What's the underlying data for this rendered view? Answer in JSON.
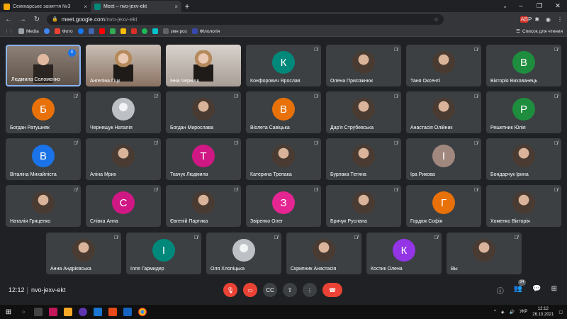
{
  "tabs": [
    {
      "label": "Семінарське заняття №3",
      "close": "×",
      "icon": "document-icon",
      "color": "#f9ab00"
    },
    {
      "label": "Meet – nvo-jexv-ekt",
      "close": "×",
      "icon": "meet-icon",
      "color": "#00897b"
    }
  ],
  "new_tab": "+",
  "window_controls": [
    "–",
    "❐",
    "✕"
  ],
  "toolbar": {
    "url_host": "meet.google.com",
    "url_path": "/nvo-jexv-ekt",
    "icons": [
      "star-icon",
      "extension-icon",
      "profile-icon",
      "menu-icon"
    ]
  },
  "bookmarks": [
    {
      "label": "Media",
      "color": "#9aa0a6"
    },
    {
      "label": "",
      "color": "#4285f4"
    },
    {
      "label": "Фото",
      "color": "#ea4335"
    },
    {
      "label": "",
      "color": "#1877f2"
    },
    {
      "label": "",
      "color": "#4267b2"
    },
    {
      "label": "",
      "color": "#ff0000"
    },
    {
      "label": "",
      "color": "#34a853"
    },
    {
      "label": "",
      "color": "#fbbc04"
    },
    {
      "label": "",
      "color": "#d93025"
    },
    {
      "label": "",
      "color": "#1db954"
    },
    {
      "label": "",
      "color": "#00c4cc"
    },
    {
      "label": "змн роз",
      "color": "#5f6368"
    },
    {
      "label": "Філологія",
      "color": "#3949ab"
    }
  ],
  "reading_list": "Список для чтения",
  "participants": [
    {
      "name": "Людмила Соломенко",
      "kind": "video"
    },
    {
      "name": "Ангеліна Гіцк",
      "kind": "video"
    },
    {
      "name": "Інна Черниш",
      "kind": "video"
    },
    {
      "name": "Конфорович Ярослав",
      "initial": "К",
      "color": "#00897b"
    },
    {
      "name": "Олена Присяжнюк",
      "kind": "photo"
    },
    {
      "name": "Таня Оксенті",
      "kind": "photo"
    },
    {
      "name": "Вікторія Вихованець",
      "initial": "В",
      "color": "#1e8e3e"
    },
    {
      "name": "Богдан Ратушняк",
      "initial": "Б",
      "color": "#e8710a"
    },
    {
      "name": "Чернещук Наталія",
      "kind": "grey"
    },
    {
      "name": "Богдан Мирослава",
      "kind": "photo"
    },
    {
      "name": "Віолета Савіцька",
      "initial": "В",
      "color": "#e8710a"
    },
    {
      "name": "Дар'я Струбевська",
      "kind": "photo"
    },
    {
      "name": "Анастасія Олійник",
      "kind": "photo"
    },
    {
      "name": "Решетник Юлія",
      "initial": "Р",
      "color": "#1e8e3e"
    },
    {
      "name": "Віталіна Михайліста",
      "initial": "В",
      "color": "#1a73e8"
    },
    {
      "name": "Аліна Мрих",
      "kind": "photo"
    },
    {
      "name": "Ткачук Людмила",
      "initial": "Т",
      "color": "#d01884"
    },
    {
      "name": "Катерина Трепака",
      "kind": "photo"
    },
    {
      "name": "Бурлака Тетяна",
      "kind": "photo"
    },
    {
      "name": "Іра Рикова",
      "initial": "І",
      "color": "#a1887f"
    },
    {
      "name": "Бондарчук Ірина",
      "kind": "photo"
    },
    {
      "name": "Наталія Гриценко",
      "kind": "photo"
    },
    {
      "name": "Слівка Анна",
      "initial": "С",
      "color": "#d01884"
    },
    {
      "name": "Євгеній Партика",
      "kind": "photo"
    },
    {
      "name": "Звіренко Олег",
      "initial": "З",
      "color": "#e52592"
    },
    {
      "name": "Бричук Руслана",
      "kind": "photo"
    },
    {
      "name": "Гордюк Софія",
      "initial": "Г",
      "color": "#e8710a"
    },
    {
      "name": "Хоменко Вікторія",
      "kind": "photo"
    },
    {
      "name": "Анна Андрієвська",
      "kind": "photo"
    },
    {
      "name": "Ілля Гармидер",
      "initial": "І",
      "color": "#00897b"
    },
    {
      "name": "Оля Хлопіцька",
      "kind": "grey"
    },
    {
      "name": "Скрипник Анастасія",
      "kind": "photo"
    },
    {
      "name": "Костик Олена",
      "initial": "К",
      "color": "#9334e6"
    },
    {
      "name": "Вы",
      "kind": "photo"
    }
  ],
  "muted_icon": "🎙̸",
  "bottom": {
    "time": "12:12",
    "meeting_code": "nvo-jexv-ekt",
    "people_count": "34"
  },
  "taskbar": {
    "lang": "УКР",
    "time": "12:12",
    "date": "26.10.2021"
  }
}
